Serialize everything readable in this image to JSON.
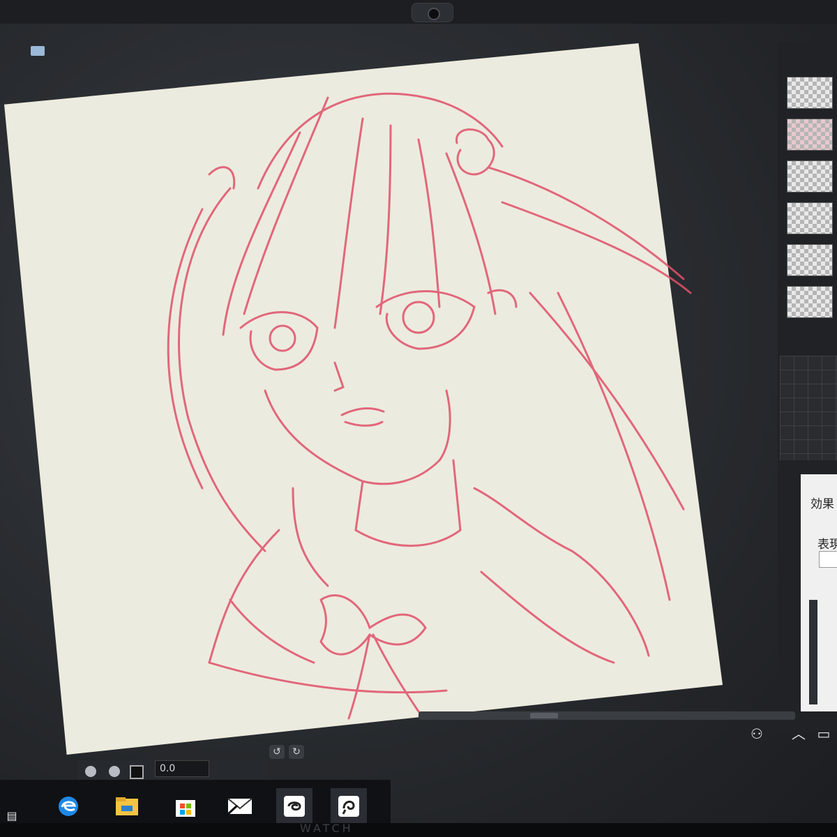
{
  "statusbar": {
    "zoom_value": "0.0"
  },
  "properties_panel": {
    "effect_label": "効果",
    "expression_label": "表現"
  },
  "taskbar": {
    "items": [
      {
        "name": "edge-browser"
      },
      {
        "name": "file-explorer"
      },
      {
        "name": "microsoft-store"
      },
      {
        "name": "mail"
      },
      {
        "name": "clip-studio-paint"
      },
      {
        "name": "clip-studio"
      }
    ]
  },
  "colors": {
    "sketch_line": "#e0506a",
    "paper": "#ecebdf",
    "workspace": "#2a2d31"
  },
  "brand_text": "WATCH"
}
